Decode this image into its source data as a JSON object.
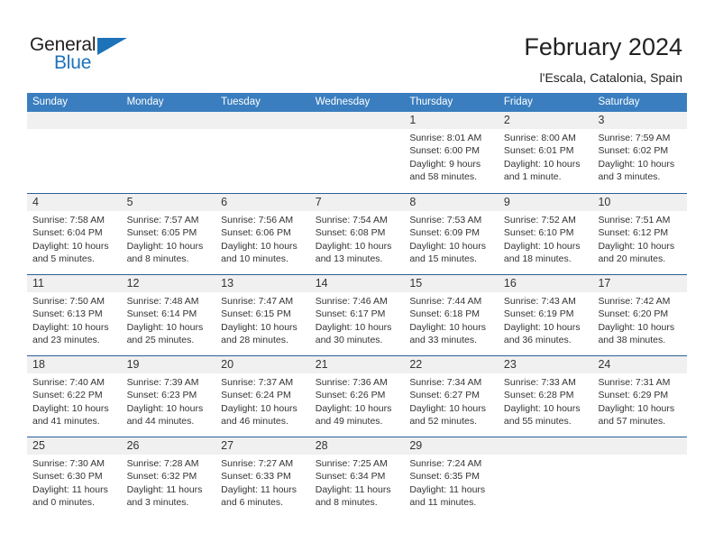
{
  "brand": {
    "name_top": "General",
    "name_bottom": "Blue",
    "accent_color": "#1d72b8"
  },
  "header": {
    "title": "February 2024",
    "subtitle": "l'Escala, Catalonia, Spain"
  },
  "calendar": {
    "header_bg": "#3a7ebf",
    "row_rule_color": "#2a6099",
    "daynum_bg": "#f0f0f0",
    "weekdays": [
      "Sunday",
      "Monday",
      "Tuesday",
      "Wednesday",
      "Thursday",
      "Friday",
      "Saturday"
    ],
    "weeks": [
      [
        {
          "day": ""
        },
        {
          "day": ""
        },
        {
          "day": ""
        },
        {
          "day": ""
        },
        {
          "day": "1",
          "sunrise": "Sunrise: 8:01 AM",
          "sunset": "Sunset: 6:00 PM",
          "daylight": "Daylight: 9 hours and 58 minutes."
        },
        {
          "day": "2",
          "sunrise": "Sunrise: 8:00 AM",
          "sunset": "Sunset: 6:01 PM",
          "daylight": "Daylight: 10 hours and 1 minute."
        },
        {
          "day": "3",
          "sunrise": "Sunrise: 7:59 AM",
          "sunset": "Sunset: 6:02 PM",
          "daylight": "Daylight: 10 hours and 3 minutes."
        }
      ],
      [
        {
          "day": "4",
          "sunrise": "Sunrise: 7:58 AM",
          "sunset": "Sunset: 6:04 PM",
          "daylight": "Daylight: 10 hours and 5 minutes."
        },
        {
          "day": "5",
          "sunrise": "Sunrise: 7:57 AM",
          "sunset": "Sunset: 6:05 PM",
          "daylight": "Daylight: 10 hours and 8 minutes."
        },
        {
          "day": "6",
          "sunrise": "Sunrise: 7:56 AM",
          "sunset": "Sunset: 6:06 PM",
          "daylight": "Daylight: 10 hours and 10 minutes."
        },
        {
          "day": "7",
          "sunrise": "Sunrise: 7:54 AM",
          "sunset": "Sunset: 6:08 PM",
          "daylight": "Daylight: 10 hours and 13 minutes."
        },
        {
          "day": "8",
          "sunrise": "Sunrise: 7:53 AM",
          "sunset": "Sunset: 6:09 PM",
          "daylight": "Daylight: 10 hours and 15 minutes."
        },
        {
          "day": "9",
          "sunrise": "Sunrise: 7:52 AM",
          "sunset": "Sunset: 6:10 PM",
          "daylight": "Daylight: 10 hours and 18 minutes."
        },
        {
          "day": "10",
          "sunrise": "Sunrise: 7:51 AM",
          "sunset": "Sunset: 6:12 PM",
          "daylight": "Daylight: 10 hours and 20 minutes."
        }
      ],
      [
        {
          "day": "11",
          "sunrise": "Sunrise: 7:50 AM",
          "sunset": "Sunset: 6:13 PM",
          "daylight": "Daylight: 10 hours and 23 minutes."
        },
        {
          "day": "12",
          "sunrise": "Sunrise: 7:48 AM",
          "sunset": "Sunset: 6:14 PM",
          "daylight": "Daylight: 10 hours and 25 minutes."
        },
        {
          "day": "13",
          "sunrise": "Sunrise: 7:47 AM",
          "sunset": "Sunset: 6:15 PM",
          "daylight": "Daylight: 10 hours and 28 minutes."
        },
        {
          "day": "14",
          "sunrise": "Sunrise: 7:46 AM",
          "sunset": "Sunset: 6:17 PM",
          "daylight": "Daylight: 10 hours and 30 minutes."
        },
        {
          "day": "15",
          "sunrise": "Sunrise: 7:44 AM",
          "sunset": "Sunset: 6:18 PM",
          "daylight": "Daylight: 10 hours and 33 minutes."
        },
        {
          "day": "16",
          "sunrise": "Sunrise: 7:43 AM",
          "sunset": "Sunset: 6:19 PM",
          "daylight": "Daylight: 10 hours and 36 minutes."
        },
        {
          "day": "17",
          "sunrise": "Sunrise: 7:42 AM",
          "sunset": "Sunset: 6:20 PM",
          "daylight": "Daylight: 10 hours and 38 minutes."
        }
      ],
      [
        {
          "day": "18",
          "sunrise": "Sunrise: 7:40 AM",
          "sunset": "Sunset: 6:22 PM",
          "daylight": "Daylight: 10 hours and 41 minutes."
        },
        {
          "day": "19",
          "sunrise": "Sunrise: 7:39 AM",
          "sunset": "Sunset: 6:23 PM",
          "daylight": "Daylight: 10 hours and 44 minutes."
        },
        {
          "day": "20",
          "sunrise": "Sunrise: 7:37 AM",
          "sunset": "Sunset: 6:24 PM",
          "daylight": "Daylight: 10 hours and 46 minutes."
        },
        {
          "day": "21",
          "sunrise": "Sunrise: 7:36 AM",
          "sunset": "Sunset: 6:26 PM",
          "daylight": "Daylight: 10 hours and 49 minutes."
        },
        {
          "day": "22",
          "sunrise": "Sunrise: 7:34 AM",
          "sunset": "Sunset: 6:27 PM",
          "daylight": "Daylight: 10 hours and 52 minutes."
        },
        {
          "day": "23",
          "sunrise": "Sunrise: 7:33 AM",
          "sunset": "Sunset: 6:28 PM",
          "daylight": "Daylight: 10 hours and 55 minutes."
        },
        {
          "day": "24",
          "sunrise": "Sunrise: 7:31 AM",
          "sunset": "Sunset: 6:29 PM",
          "daylight": "Daylight: 10 hours and 57 minutes."
        }
      ],
      [
        {
          "day": "25",
          "sunrise": "Sunrise: 7:30 AM",
          "sunset": "Sunset: 6:30 PM",
          "daylight": "Daylight: 11 hours and 0 minutes."
        },
        {
          "day": "26",
          "sunrise": "Sunrise: 7:28 AM",
          "sunset": "Sunset: 6:32 PM",
          "daylight": "Daylight: 11 hours and 3 minutes."
        },
        {
          "day": "27",
          "sunrise": "Sunrise: 7:27 AM",
          "sunset": "Sunset: 6:33 PM",
          "daylight": "Daylight: 11 hours and 6 minutes."
        },
        {
          "day": "28",
          "sunrise": "Sunrise: 7:25 AM",
          "sunset": "Sunset: 6:34 PM",
          "daylight": "Daylight: 11 hours and 8 minutes."
        },
        {
          "day": "29",
          "sunrise": "Sunrise: 7:24 AM",
          "sunset": "Sunset: 6:35 PM",
          "daylight": "Daylight: 11 hours and 11 minutes."
        },
        {
          "day": ""
        },
        {
          "day": ""
        }
      ]
    ]
  }
}
